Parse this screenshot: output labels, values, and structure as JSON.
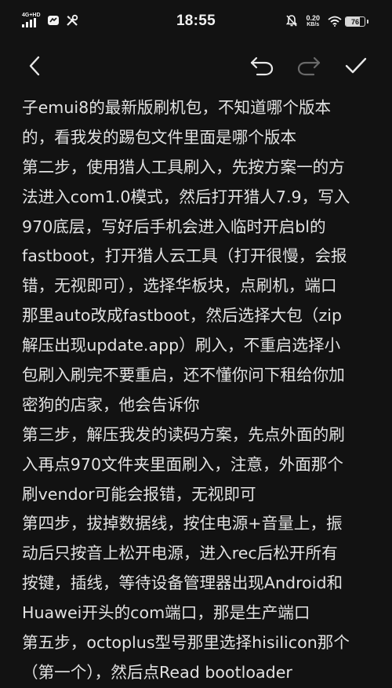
{
  "status_bar": {
    "network_label": "4G+HD",
    "time": "18:55",
    "speed_value": "0.20",
    "speed_unit": "KB/s",
    "battery_level": "76",
    "battery_fraction": 0.76
  },
  "toolbar": {
    "back_icon": "chevron-left-icon",
    "undo_icon": "undo-icon",
    "redo_icon": "redo-icon",
    "confirm_icon": "checkmark-icon",
    "redo_enabled": false
  },
  "note": {
    "lines": [
      "子emui8的最新版刷机包，不知道哪个版本",
      "的，看我发的踢包文件里面是哪个版本",
      "第二步，使用猎人工具刷入，先按方案一的方",
      "法进入com1.0模式，然后打开猎人7.9，写入",
      "970底层，写好后手机会进入临时开启bl的",
      "fastboot，打开猎人云工具（打开很慢，会报",
      "错，无视即可），选择华板块，点刷机，端口",
      "那里auto改成fastboot，然后选择大包（zip",
      "解压出现update.app）刷入，不重启选择小",
      "包刷入刷完不要重启，还不懂你问下租给你加",
      "密狗的店家，他会告诉你",
      "第三步，解压我发的读码方案，先点外面的刷",
      "入再点970文件夹里面刷入，注意，外面那个",
      "刷vendor可能会报错，无视即可",
      "第四步，拔掉数据线，按住电源+音量上，振",
      "动后只按音上松开电源，进入rec后松开所有",
      "按键，插线，等待设备管理器出现Android和",
      "Huawei开头的com端口，那是生产端口",
      "第五步，octoplus型号那里选择hisilicon那个",
      "（第一个），然后点Read bootloader"
    ]
  },
  "colors": {
    "background": "#121212",
    "text": "#e2e2e2",
    "icon": "#e8e8e8",
    "icon_disabled": "#6a6a6a"
  }
}
